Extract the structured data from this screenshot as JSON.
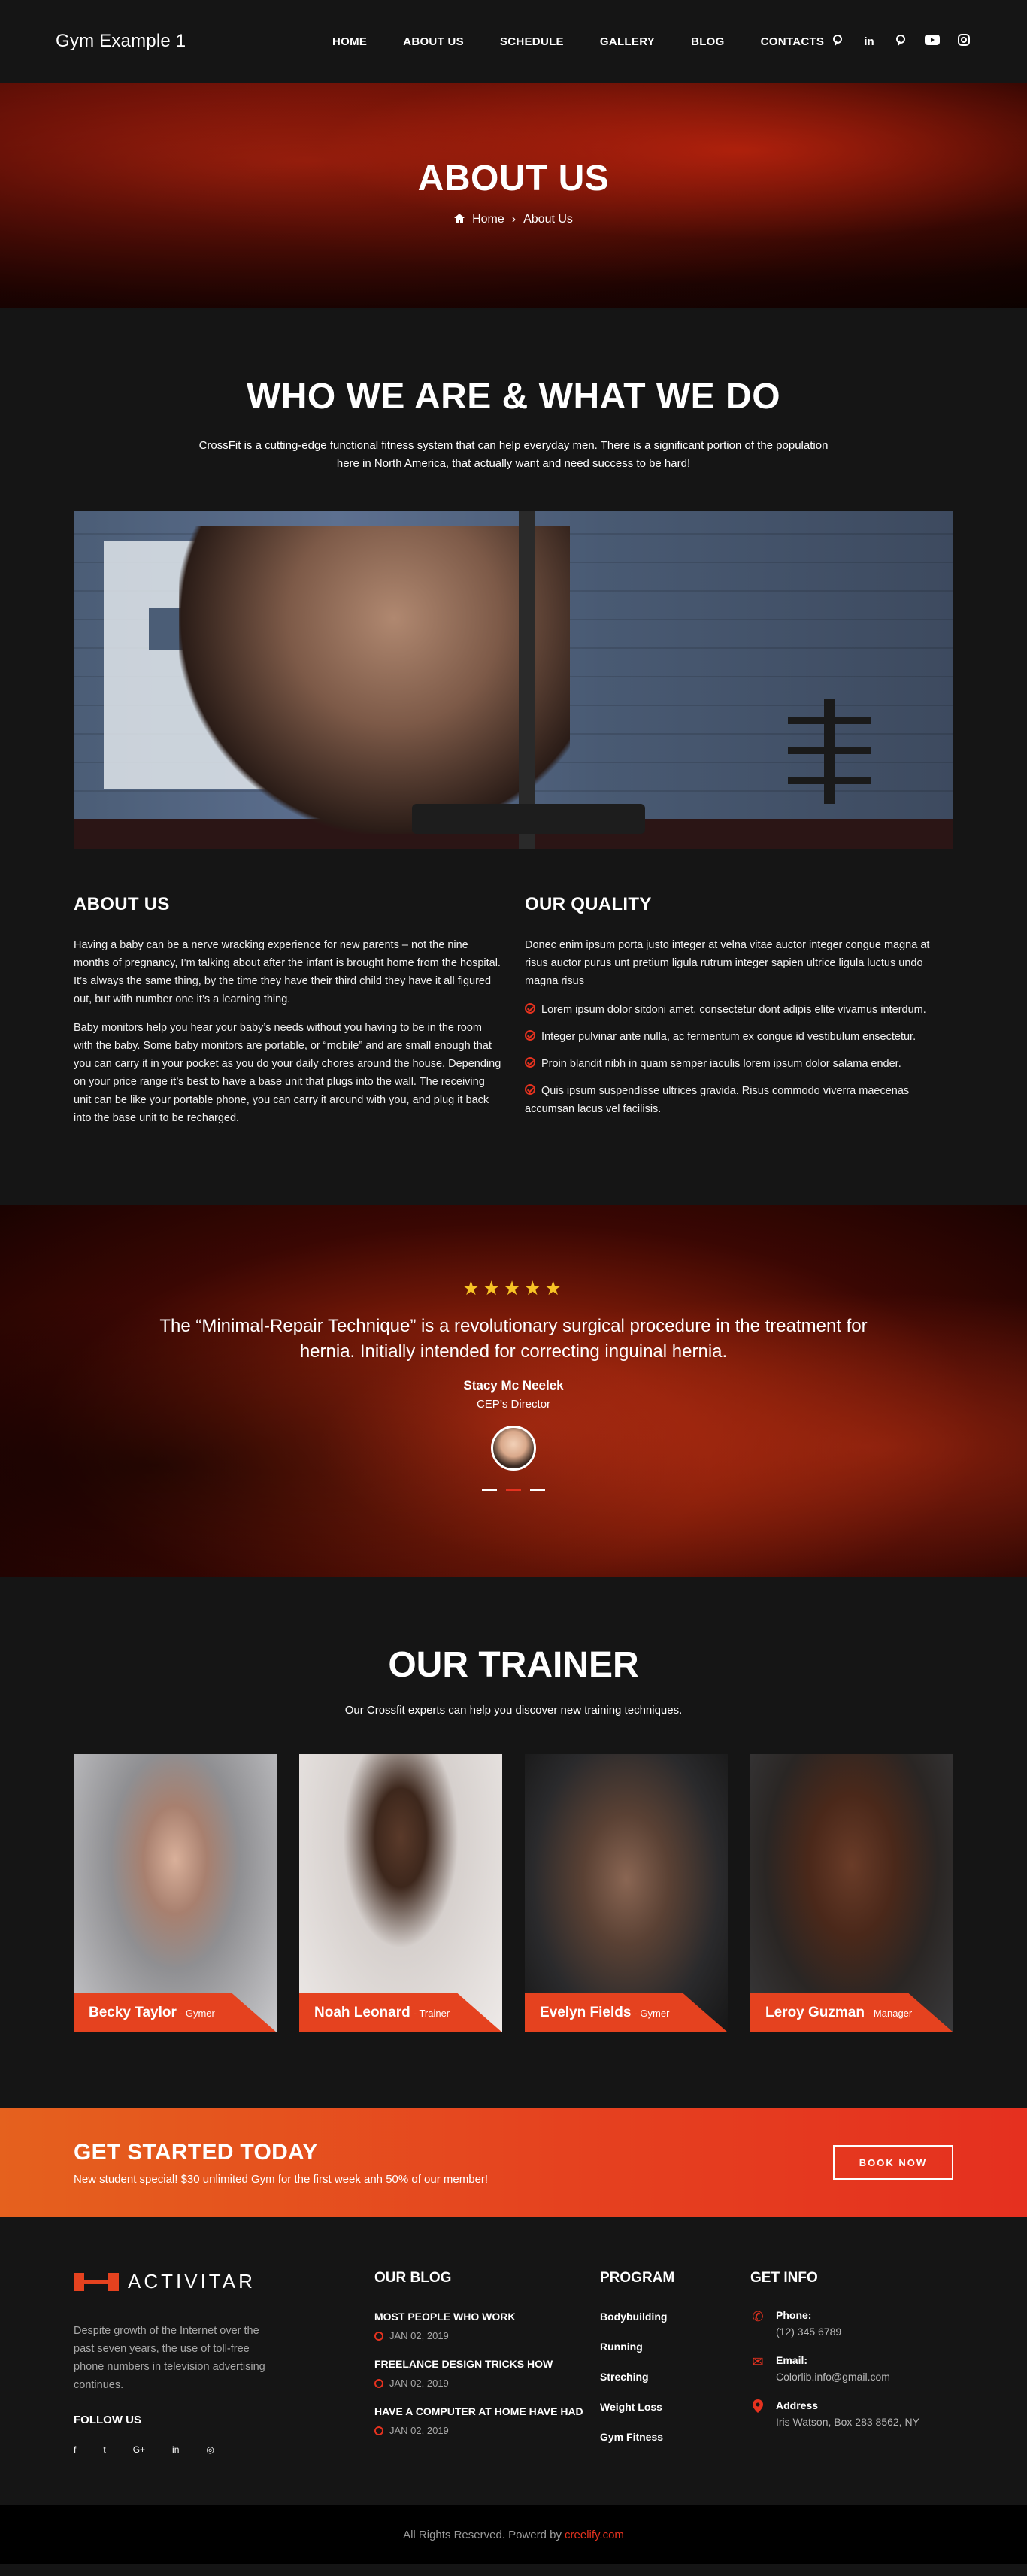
{
  "header": {
    "logo": "Gym Example 1",
    "nav": [
      "HOME",
      "ABOUT US",
      "SCHEDULE",
      "GALLERY",
      "BLOG",
      "CONTACTS"
    ],
    "social": [
      "pinterest-icon",
      "linkedin-icon",
      "pinterest-icon",
      "youtube-icon",
      "instagram-icon"
    ]
  },
  "hero": {
    "title": "ABOUT US",
    "crumb_home": "Home",
    "crumb_current": "About Us"
  },
  "who": {
    "title": "WHO WE ARE & WHAT WE DO",
    "lead": "CrossFit is a cutting-edge functional fitness system that can help everyday men. There is a significant portion of the population here in North America, that actually want and need success to be hard!"
  },
  "about": {
    "title": "ABOUT US",
    "p1": "Having a baby can be a nerve wracking experience for new parents – not the nine months of pregnancy, I’m talking about after the infant is brought home from the hospital. It’s always the same thing, by the time they have their third child they have it all figured out, but with number one it’s a learning thing.",
    "p2": "Baby monitors help you hear your baby’s needs without you having to be in the room with the baby. Some baby monitors are portable, or “mobile” and are small enough that you can carry it in your pocket as you do your daily chores around the house. Depending on your price range it’s best to have a base unit that plugs into the wall. The receiving unit can be like your portable phone, you can carry it around with you, and plug it back into the base unit to be recharged."
  },
  "quality": {
    "title": "OUR QUALITY",
    "intro": "Donec enim ipsum porta justo integer at velna vitae auctor integer congue magna at risus auctor purus unt pretium ligula rutrum integer sapien ultrice ligula luctus undo magna risus",
    "items": [
      "Lorem ipsum dolor sitdoni amet, consectetur dont adipis elite vivamus interdum.",
      "Integer pulvinar ante nulla, ac fermentum ex congue id vestibulum ensectetur.",
      "Proin blandit nibh in quam semper iaculis lorem ipsum dolor salama ender.",
      "Quis ipsum suspendisse ultrices gravida. Risus commodo viverra maecenas accumsan lacus vel facilisis."
    ]
  },
  "testimonial": {
    "stars": "★★★★★",
    "rating": 5,
    "quote": "The “Minimal-Repair Technique” is a revolutionary surgical procedure in the treatment for hernia. Initially intended for correcting inguinal hernia.",
    "author": "Stacy Mc Neelek",
    "role": "CEP’s Director"
  },
  "trainers": {
    "title": "OUR TRAINER",
    "lead": "Our Crossfit experts can help you discover new training techniques.",
    "items": [
      {
        "name": "Becky Taylor",
        "job": "- Gymer"
      },
      {
        "name": "Noah Leonard",
        "job": "- Trainer"
      },
      {
        "name": "Evelyn Fields",
        "job": "- Gymer"
      },
      {
        "name": "Leroy Guzman",
        "job": "- Manager"
      }
    ]
  },
  "cta": {
    "title": "GET STARTED TODAY",
    "text": "New student special! $30 unlimited Gym for the first week anh 50% of our member!",
    "button": "BOOK NOW"
  },
  "footer": {
    "logo": "ACTIVITAR",
    "desc": "Despite growth of the Internet over the past seven years, the use of toll-free phone numbers in television advertising continues.",
    "follow": "FOLLOW US",
    "social": [
      "f",
      "t",
      "G+",
      "in",
      "◎"
    ],
    "blog_title": "OUR BLOG",
    "blog": [
      {
        "title": "MOST PEOPLE WHO WORK",
        "date": "JAN 02, 2019"
      },
      {
        "title": "FREELANCE DESIGN TRICKS HOW",
        "date": "JAN 02, 2019"
      },
      {
        "title": "HAVE A COMPUTER AT HOME HAVE HAD",
        "date": "JAN 02, 2019"
      }
    ],
    "program_title": "PROGRAM",
    "program": [
      "Bodybuilding",
      "Running",
      "Streching",
      "Weight Loss",
      "Gym Fitness"
    ],
    "info_title": "GET INFO",
    "info": [
      {
        "key": "Phone:",
        "value": "(12) 345 6789"
      },
      {
        "key": "Email:",
        "value": "Colorlib.info@gmail.com"
      },
      {
        "key": "Address",
        "value": "Iris Watson, Box 283 8562, NY"
      }
    ]
  },
  "bottom": {
    "text": "All Rights Reserved. Powerd by",
    "brand": "creelify.com"
  },
  "colors": {
    "accent": "#e5421f",
    "bg": "#151515"
  }
}
